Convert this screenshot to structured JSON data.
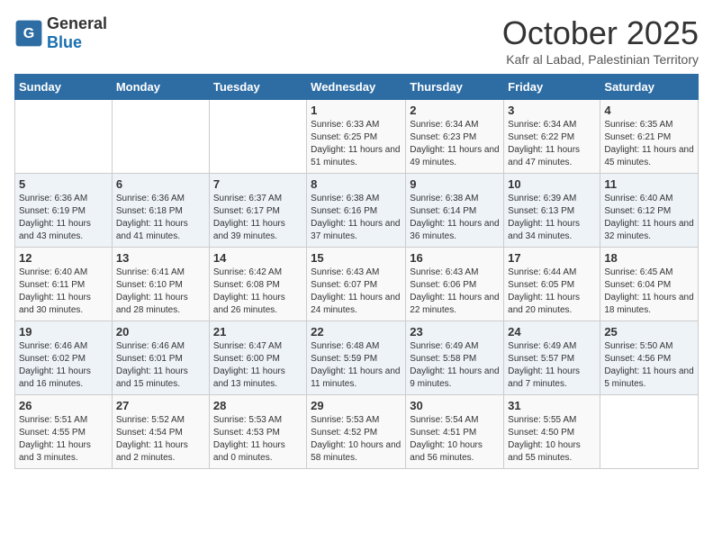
{
  "logo": {
    "general": "General",
    "blue": "Blue"
  },
  "header": {
    "month": "October 2025",
    "location": "Kafr al Labad, Palestinian Territory"
  },
  "weekdays": [
    "Sunday",
    "Monday",
    "Tuesday",
    "Wednesday",
    "Thursday",
    "Friday",
    "Saturday"
  ],
  "weeks": [
    [
      {
        "day": "",
        "text": ""
      },
      {
        "day": "",
        "text": ""
      },
      {
        "day": "",
        "text": ""
      },
      {
        "day": "1",
        "text": "Sunrise: 6:33 AM\nSunset: 6:25 PM\nDaylight: 11 hours and 51 minutes."
      },
      {
        "day": "2",
        "text": "Sunrise: 6:34 AM\nSunset: 6:23 PM\nDaylight: 11 hours and 49 minutes."
      },
      {
        "day": "3",
        "text": "Sunrise: 6:34 AM\nSunset: 6:22 PM\nDaylight: 11 hours and 47 minutes."
      },
      {
        "day": "4",
        "text": "Sunrise: 6:35 AM\nSunset: 6:21 PM\nDaylight: 11 hours and 45 minutes."
      }
    ],
    [
      {
        "day": "5",
        "text": "Sunrise: 6:36 AM\nSunset: 6:19 PM\nDaylight: 11 hours and 43 minutes."
      },
      {
        "day": "6",
        "text": "Sunrise: 6:36 AM\nSunset: 6:18 PM\nDaylight: 11 hours and 41 minutes."
      },
      {
        "day": "7",
        "text": "Sunrise: 6:37 AM\nSunset: 6:17 PM\nDaylight: 11 hours and 39 minutes."
      },
      {
        "day": "8",
        "text": "Sunrise: 6:38 AM\nSunset: 6:16 PM\nDaylight: 11 hours and 37 minutes."
      },
      {
        "day": "9",
        "text": "Sunrise: 6:38 AM\nSunset: 6:14 PM\nDaylight: 11 hours and 36 minutes."
      },
      {
        "day": "10",
        "text": "Sunrise: 6:39 AM\nSunset: 6:13 PM\nDaylight: 11 hours and 34 minutes."
      },
      {
        "day": "11",
        "text": "Sunrise: 6:40 AM\nSunset: 6:12 PM\nDaylight: 11 hours and 32 minutes."
      }
    ],
    [
      {
        "day": "12",
        "text": "Sunrise: 6:40 AM\nSunset: 6:11 PM\nDaylight: 11 hours and 30 minutes."
      },
      {
        "day": "13",
        "text": "Sunrise: 6:41 AM\nSunset: 6:10 PM\nDaylight: 11 hours and 28 minutes."
      },
      {
        "day": "14",
        "text": "Sunrise: 6:42 AM\nSunset: 6:08 PM\nDaylight: 11 hours and 26 minutes."
      },
      {
        "day": "15",
        "text": "Sunrise: 6:43 AM\nSunset: 6:07 PM\nDaylight: 11 hours and 24 minutes."
      },
      {
        "day": "16",
        "text": "Sunrise: 6:43 AM\nSunset: 6:06 PM\nDaylight: 11 hours and 22 minutes."
      },
      {
        "day": "17",
        "text": "Sunrise: 6:44 AM\nSunset: 6:05 PM\nDaylight: 11 hours and 20 minutes."
      },
      {
        "day": "18",
        "text": "Sunrise: 6:45 AM\nSunset: 6:04 PM\nDaylight: 11 hours and 18 minutes."
      }
    ],
    [
      {
        "day": "19",
        "text": "Sunrise: 6:46 AM\nSunset: 6:02 PM\nDaylight: 11 hours and 16 minutes."
      },
      {
        "day": "20",
        "text": "Sunrise: 6:46 AM\nSunset: 6:01 PM\nDaylight: 11 hours and 15 minutes."
      },
      {
        "day": "21",
        "text": "Sunrise: 6:47 AM\nSunset: 6:00 PM\nDaylight: 11 hours and 13 minutes."
      },
      {
        "day": "22",
        "text": "Sunrise: 6:48 AM\nSunset: 5:59 PM\nDaylight: 11 hours and 11 minutes."
      },
      {
        "day": "23",
        "text": "Sunrise: 6:49 AM\nSunset: 5:58 PM\nDaylight: 11 hours and 9 minutes."
      },
      {
        "day": "24",
        "text": "Sunrise: 6:49 AM\nSunset: 5:57 PM\nDaylight: 11 hours and 7 minutes."
      },
      {
        "day": "25",
        "text": "Sunrise: 5:50 AM\nSunset: 4:56 PM\nDaylight: 11 hours and 5 minutes."
      }
    ],
    [
      {
        "day": "26",
        "text": "Sunrise: 5:51 AM\nSunset: 4:55 PM\nDaylight: 11 hours and 3 minutes."
      },
      {
        "day": "27",
        "text": "Sunrise: 5:52 AM\nSunset: 4:54 PM\nDaylight: 11 hours and 2 minutes."
      },
      {
        "day": "28",
        "text": "Sunrise: 5:53 AM\nSunset: 4:53 PM\nDaylight: 11 hours and 0 minutes."
      },
      {
        "day": "29",
        "text": "Sunrise: 5:53 AM\nSunset: 4:52 PM\nDaylight: 10 hours and 58 minutes."
      },
      {
        "day": "30",
        "text": "Sunrise: 5:54 AM\nSunset: 4:51 PM\nDaylight: 10 hours and 56 minutes."
      },
      {
        "day": "31",
        "text": "Sunrise: 5:55 AM\nSunset: 4:50 PM\nDaylight: 10 hours and 55 minutes."
      },
      {
        "day": "",
        "text": ""
      }
    ]
  ]
}
